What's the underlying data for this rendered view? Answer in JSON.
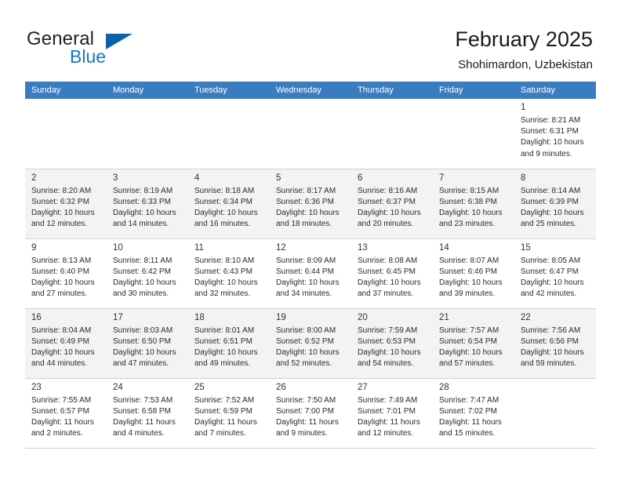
{
  "brand": {
    "name_part1": "General",
    "name_part2": "Blue",
    "accent_color": "#1278be",
    "triangle_color": "#0c62a8"
  },
  "header": {
    "title": "February 2025",
    "subtitle": "Shohimardon, Uzbekistan"
  },
  "theme": {
    "header_row_bg": "#3a7cc0",
    "alt_row_bg": "#f3f3f3",
    "grid_line": "#c8d4e2"
  },
  "calendar": {
    "weekday_headers": [
      "Sunday",
      "Monday",
      "Tuesday",
      "Wednesday",
      "Thursday",
      "Friday",
      "Saturday"
    ],
    "weeks": [
      [
        {
          "day": "",
          "lines": []
        },
        {
          "day": "",
          "lines": []
        },
        {
          "day": "",
          "lines": []
        },
        {
          "day": "",
          "lines": []
        },
        {
          "day": "",
          "lines": []
        },
        {
          "day": "",
          "lines": []
        },
        {
          "day": "1",
          "lines": [
            "Sunrise: 8:21 AM",
            "Sunset: 6:31 PM",
            "Daylight: 10 hours",
            "and 9 minutes."
          ]
        }
      ],
      [
        {
          "day": "2",
          "lines": [
            "Sunrise: 8:20 AM",
            "Sunset: 6:32 PM",
            "Daylight: 10 hours",
            "and 12 minutes."
          ]
        },
        {
          "day": "3",
          "lines": [
            "Sunrise: 8:19 AM",
            "Sunset: 6:33 PM",
            "Daylight: 10 hours",
            "and 14 minutes."
          ]
        },
        {
          "day": "4",
          "lines": [
            "Sunrise: 8:18 AM",
            "Sunset: 6:34 PM",
            "Daylight: 10 hours",
            "and 16 minutes."
          ]
        },
        {
          "day": "5",
          "lines": [
            "Sunrise: 8:17 AM",
            "Sunset: 6:36 PM",
            "Daylight: 10 hours",
            "and 18 minutes."
          ]
        },
        {
          "day": "6",
          "lines": [
            "Sunrise: 8:16 AM",
            "Sunset: 6:37 PM",
            "Daylight: 10 hours",
            "and 20 minutes."
          ]
        },
        {
          "day": "7",
          "lines": [
            "Sunrise: 8:15 AM",
            "Sunset: 6:38 PM",
            "Daylight: 10 hours",
            "and 23 minutes."
          ]
        },
        {
          "day": "8",
          "lines": [
            "Sunrise: 8:14 AM",
            "Sunset: 6:39 PM",
            "Daylight: 10 hours",
            "and 25 minutes."
          ]
        }
      ],
      [
        {
          "day": "9",
          "lines": [
            "Sunrise: 8:13 AM",
            "Sunset: 6:40 PM",
            "Daylight: 10 hours",
            "and 27 minutes."
          ]
        },
        {
          "day": "10",
          "lines": [
            "Sunrise: 8:11 AM",
            "Sunset: 6:42 PM",
            "Daylight: 10 hours",
            "and 30 minutes."
          ]
        },
        {
          "day": "11",
          "lines": [
            "Sunrise: 8:10 AM",
            "Sunset: 6:43 PM",
            "Daylight: 10 hours",
            "and 32 minutes."
          ]
        },
        {
          "day": "12",
          "lines": [
            "Sunrise: 8:09 AM",
            "Sunset: 6:44 PM",
            "Daylight: 10 hours",
            "and 34 minutes."
          ]
        },
        {
          "day": "13",
          "lines": [
            "Sunrise: 8:08 AM",
            "Sunset: 6:45 PM",
            "Daylight: 10 hours",
            "and 37 minutes."
          ]
        },
        {
          "day": "14",
          "lines": [
            "Sunrise: 8:07 AM",
            "Sunset: 6:46 PM",
            "Daylight: 10 hours",
            "and 39 minutes."
          ]
        },
        {
          "day": "15",
          "lines": [
            "Sunrise: 8:05 AM",
            "Sunset: 6:47 PM",
            "Daylight: 10 hours",
            "and 42 minutes."
          ]
        }
      ],
      [
        {
          "day": "16",
          "lines": [
            "Sunrise: 8:04 AM",
            "Sunset: 6:49 PM",
            "Daylight: 10 hours",
            "and 44 minutes."
          ]
        },
        {
          "day": "17",
          "lines": [
            "Sunrise: 8:03 AM",
            "Sunset: 6:50 PM",
            "Daylight: 10 hours",
            "and 47 minutes."
          ]
        },
        {
          "day": "18",
          "lines": [
            "Sunrise: 8:01 AM",
            "Sunset: 6:51 PM",
            "Daylight: 10 hours",
            "and 49 minutes."
          ]
        },
        {
          "day": "19",
          "lines": [
            "Sunrise: 8:00 AM",
            "Sunset: 6:52 PM",
            "Daylight: 10 hours",
            "and 52 minutes."
          ]
        },
        {
          "day": "20",
          "lines": [
            "Sunrise: 7:59 AM",
            "Sunset: 6:53 PM",
            "Daylight: 10 hours",
            "and 54 minutes."
          ]
        },
        {
          "day": "21",
          "lines": [
            "Sunrise: 7:57 AM",
            "Sunset: 6:54 PM",
            "Daylight: 10 hours",
            "and 57 minutes."
          ]
        },
        {
          "day": "22",
          "lines": [
            "Sunrise: 7:56 AM",
            "Sunset: 6:56 PM",
            "Daylight: 10 hours",
            "and 59 minutes."
          ]
        }
      ],
      [
        {
          "day": "23",
          "lines": [
            "Sunrise: 7:55 AM",
            "Sunset: 6:57 PM",
            "Daylight: 11 hours",
            "and 2 minutes."
          ]
        },
        {
          "day": "24",
          "lines": [
            "Sunrise: 7:53 AM",
            "Sunset: 6:58 PM",
            "Daylight: 11 hours",
            "and 4 minutes."
          ]
        },
        {
          "day": "25",
          "lines": [
            "Sunrise: 7:52 AM",
            "Sunset: 6:59 PM",
            "Daylight: 11 hours",
            "and 7 minutes."
          ]
        },
        {
          "day": "26",
          "lines": [
            "Sunrise: 7:50 AM",
            "Sunset: 7:00 PM",
            "Daylight: 11 hours",
            "and 9 minutes."
          ]
        },
        {
          "day": "27",
          "lines": [
            "Sunrise: 7:49 AM",
            "Sunset: 7:01 PM",
            "Daylight: 11 hours",
            "and 12 minutes."
          ]
        },
        {
          "day": "28",
          "lines": [
            "Sunrise: 7:47 AM",
            "Sunset: 7:02 PM",
            "Daylight: 11 hours",
            "and 15 minutes."
          ]
        },
        {
          "day": "",
          "lines": []
        }
      ]
    ]
  }
}
